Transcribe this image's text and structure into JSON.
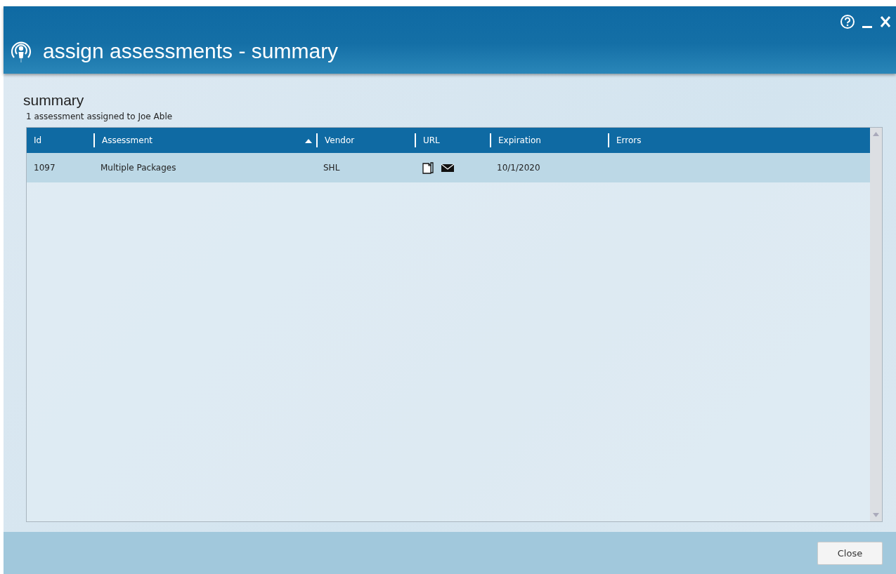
{
  "window": {
    "title": "assign assessments - summary"
  },
  "section": {
    "heading": "summary",
    "subtitle": "1 assessment assigned to Joe Able"
  },
  "table": {
    "columns": [
      {
        "label": "Id",
        "sorted": false
      },
      {
        "label": "Assessment",
        "sorted": true
      },
      {
        "label": "Vendor",
        "sorted": false
      },
      {
        "label": "URL",
        "sorted": false
      },
      {
        "label": "Expiration",
        "sorted": false
      },
      {
        "label": "Errors",
        "sorted": false
      }
    ],
    "rows": [
      {
        "selected": true,
        "cells": [
          {
            "kind": "text",
            "text": "1097"
          },
          {
            "kind": "text",
            "text": "Multiple Packages"
          },
          {
            "kind": "text",
            "text": "SHL"
          },
          {
            "kind": "url_actions"
          },
          {
            "kind": "text",
            "text": "10/1/2020"
          },
          {
            "kind": "empty"
          }
        ]
      }
    ]
  },
  "buttons": [
    "Close"
  ]
}
